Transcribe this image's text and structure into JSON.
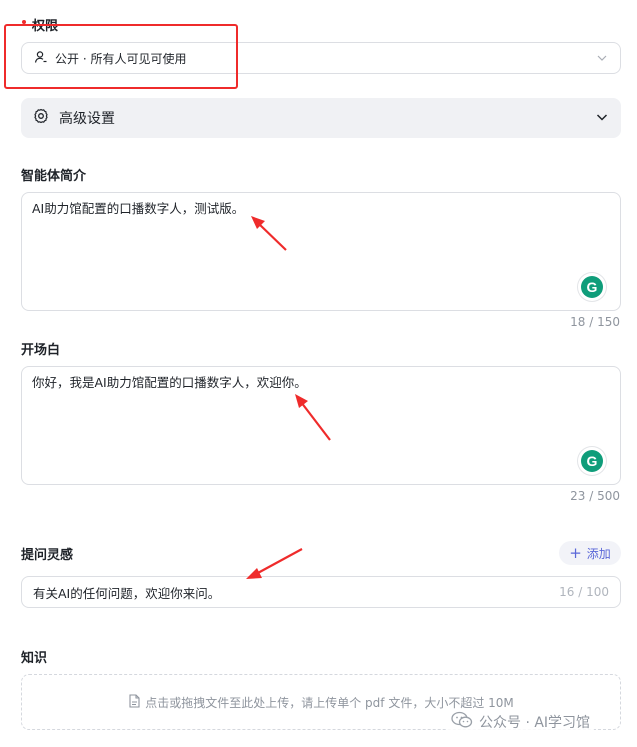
{
  "permissions": {
    "label": "权限",
    "select_value": "公开 · 所有人可见可使用"
  },
  "advanced": {
    "label": "高级设置"
  },
  "intro": {
    "label": "智能体简介",
    "value": "AI助力馆配置的口播数字人，测试版。",
    "counter": "18 / 150"
  },
  "opening": {
    "label": "开场白",
    "value": "你好，我是AI助力馆配置的口播数字人，欢迎你。",
    "counter": "23 / 500"
  },
  "prompts": {
    "label": "提问灵感",
    "add_label": "添加",
    "value": "有关AI的任何问题，欢迎你来问。",
    "counter": "16 / 100"
  },
  "knowledge": {
    "label": "知识",
    "upload_hint": "点击或拖拽文件至此处上传，请上传单个 pdf 文件，大小不超过 10M"
  },
  "watermark": {
    "text": "公众号 · AI学习馆"
  },
  "grammarly_badge": "G",
  "colors": {
    "annotation_red": "#ef2b2b",
    "accent": "#5a67d8",
    "grammarly_green": "#0f9d7a"
  },
  "icons": {
    "permission": "user-icon",
    "advanced": "gear-icon",
    "dropdown": "chevron-down-icon",
    "file": "file-icon",
    "watermark": "wechat-icon"
  }
}
